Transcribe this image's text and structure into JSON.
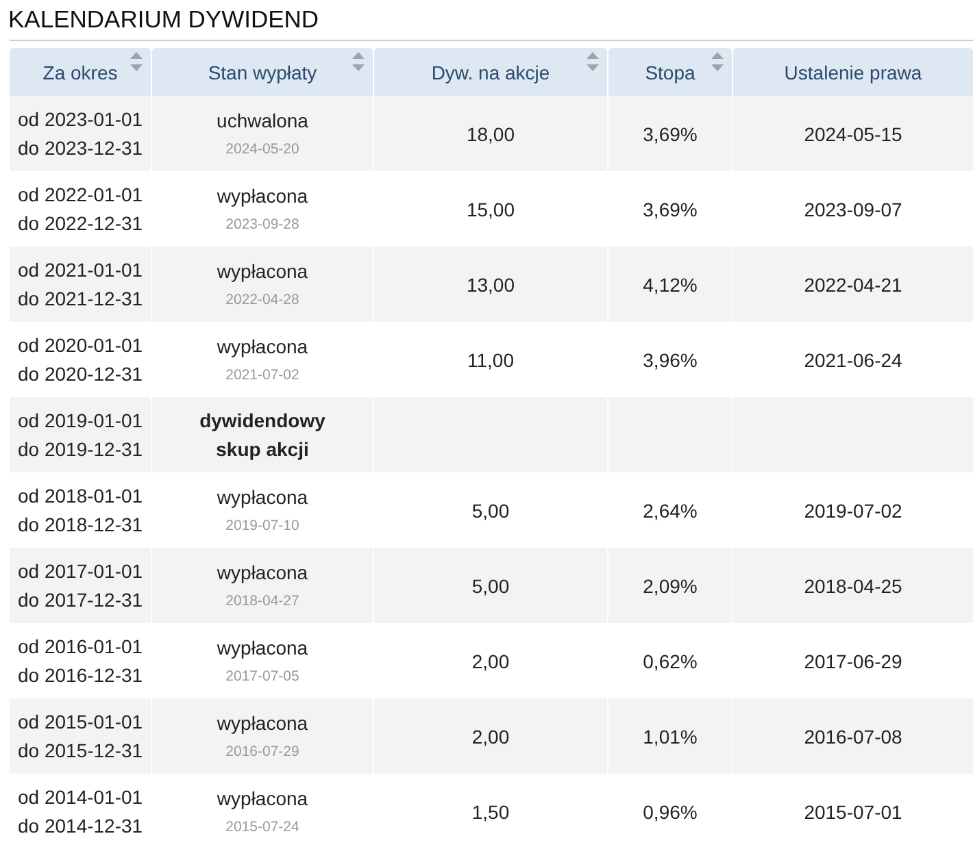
{
  "title": "KALENDARIUM DYWIDEND",
  "table": {
    "columns": [
      {
        "label": "Za okres",
        "sortable": true
      },
      {
        "label": "Stan wypłaty",
        "sortable": true
      },
      {
        "label": "Dyw. na akcje",
        "sortable": true
      },
      {
        "label": "Stopa",
        "sortable": true
      },
      {
        "label": "Ustalenie prawa",
        "sortable": false
      }
    ],
    "rows": [
      {
        "period_from": "od 2023-01-01",
        "period_to": "do 2023-12-31",
        "kind": "payout",
        "status": "uchwalona",
        "status_date": "2024-05-20",
        "dividend": "18,00",
        "rate": "3,69%",
        "record_date": "2024-05-15"
      },
      {
        "period_from": "od 2022-01-01",
        "period_to": "do 2022-12-31",
        "kind": "payout",
        "status": "wypłacona",
        "status_date": "2023-09-28",
        "dividend": "15,00",
        "rate": "3,69%",
        "record_date": "2023-09-07"
      },
      {
        "period_from": "od 2021-01-01",
        "period_to": "do 2021-12-31",
        "kind": "payout",
        "status": "wypłacona",
        "status_date": "2022-04-28",
        "dividend": "13,00",
        "rate": "4,12%",
        "record_date": "2022-04-21"
      },
      {
        "period_from": "od 2020-01-01",
        "period_to": "do 2020-12-31",
        "kind": "payout",
        "status": "wypłacona",
        "status_date": "2021-07-02",
        "dividend": "11,00",
        "rate": "3,96%",
        "record_date": "2021-06-24"
      },
      {
        "period_from": "od 2019-01-01",
        "period_to": "do 2019-12-31",
        "kind": "buyback",
        "status": "dywidendowy skup akcji"
      },
      {
        "period_from": "od 2018-01-01",
        "period_to": "do 2018-12-31",
        "kind": "payout",
        "status": "wypłacona",
        "status_date": "2019-07-10",
        "dividend": "5,00",
        "rate": "2,64%",
        "record_date": "2019-07-02"
      },
      {
        "period_from": "od 2017-01-01",
        "period_to": "do 2017-12-31",
        "kind": "payout",
        "status": "wypłacona",
        "status_date": "2018-04-27",
        "dividend": "5,00",
        "rate": "2,09%",
        "record_date": "2018-04-25"
      },
      {
        "period_from": "od 2016-01-01",
        "period_to": "do 2016-12-31",
        "kind": "payout",
        "status": "wypłacona",
        "status_date": "2017-07-05",
        "dividend": "2,00",
        "rate": "0,62%",
        "record_date": "2017-06-29"
      },
      {
        "period_from": "od 2015-01-01",
        "period_to": "do 2015-12-31",
        "kind": "payout",
        "status": "wypłacona",
        "status_date": "2016-07-29",
        "dividend": "2,00",
        "rate": "1,01%",
        "record_date": "2016-07-08"
      },
      {
        "period_from": "od 2014-01-01",
        "period_to": "do 2014-12-31",
        "kind": "payout",
        "status": "wypłacona",
        "status_date": "2015-07-24",
        "dividend": "1,50",
        "rate": "0,96%",
        "record_date": "2015-07-01"
      }
    ]
  }
}
